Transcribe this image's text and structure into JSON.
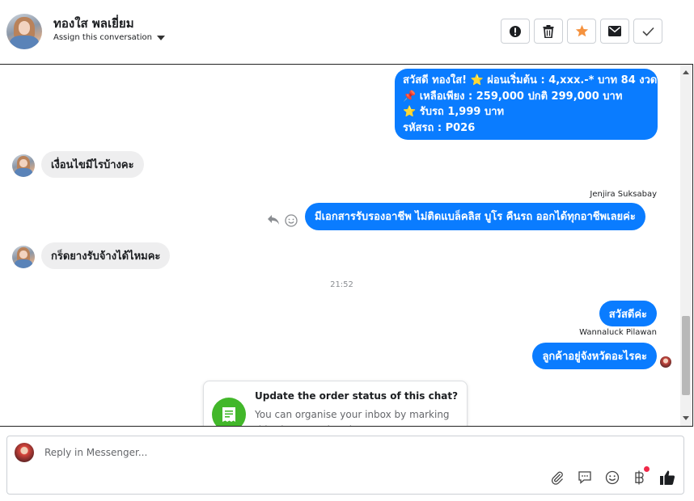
{
  "header": {
    "contact_name": "ทองใส พลเยี่ยม",
    "assign_label": "Assign this conversation",
    "actions": [
      "spam-icon",
      "trash-icon",
      "star-icon",
      "mail-icon",
      "check-icon"
    ],
    "star_color": "#f5923e"
  },
  "messages": {
    "promo": {
      "lines": [
        "สวัสดี ทองใส! ⭐ ผ่อนเริ่มต้น : 4,xxx.-* บาท 84 งวด",
        "📌 เหลือเพียง : 259,000 ปกติ 299,000 บาท",
        "⭐ รับรถ 1,999 บาท",
        "รหัสรถ : P026"
      ]
    },
    "incoming_1": "เงื่อนไขมีไรบ้างคะ",
    "sender_1": "Jenjira Suksabay",
    "outgoing_1": "มีเอกสารรับรองอาชีพ ไม่ติดแบล็คลิส บูโร คืนรถ ออกได้ทุกอาชีพเลยค่ะ",
    "incoming_2": "กร็ดยางรับจ้างได้ไหมคะ",
    "timestamp": "21:52",
    "outgoing_2": "สวัสดีค่ะ",
    "sender_2": "Wannaluck Pilawan",
    "outgoing_3": "ลูกค้าอยู่จังหวัดอะไรคะ"
  },
  "order_card": {
    "title": "Update the order status of this chat?",
    "description": "You can organise your inbox by marking this chat as ordered."
  },
  "composer": {
    "placeholder": "Reply in Messenger...",
    "tools": [
      "attachment-icon",
      "saved-replies-icon",
      "emoji-icon",
      "payment-icon",
      "like-icon"
    ]
  },
  "colors": {
    "outgoing_bubble": "#0a7cff",
    "incoming_bubble": "#eeeeef",
    "order_icon": "#42b72a"
  }
}
